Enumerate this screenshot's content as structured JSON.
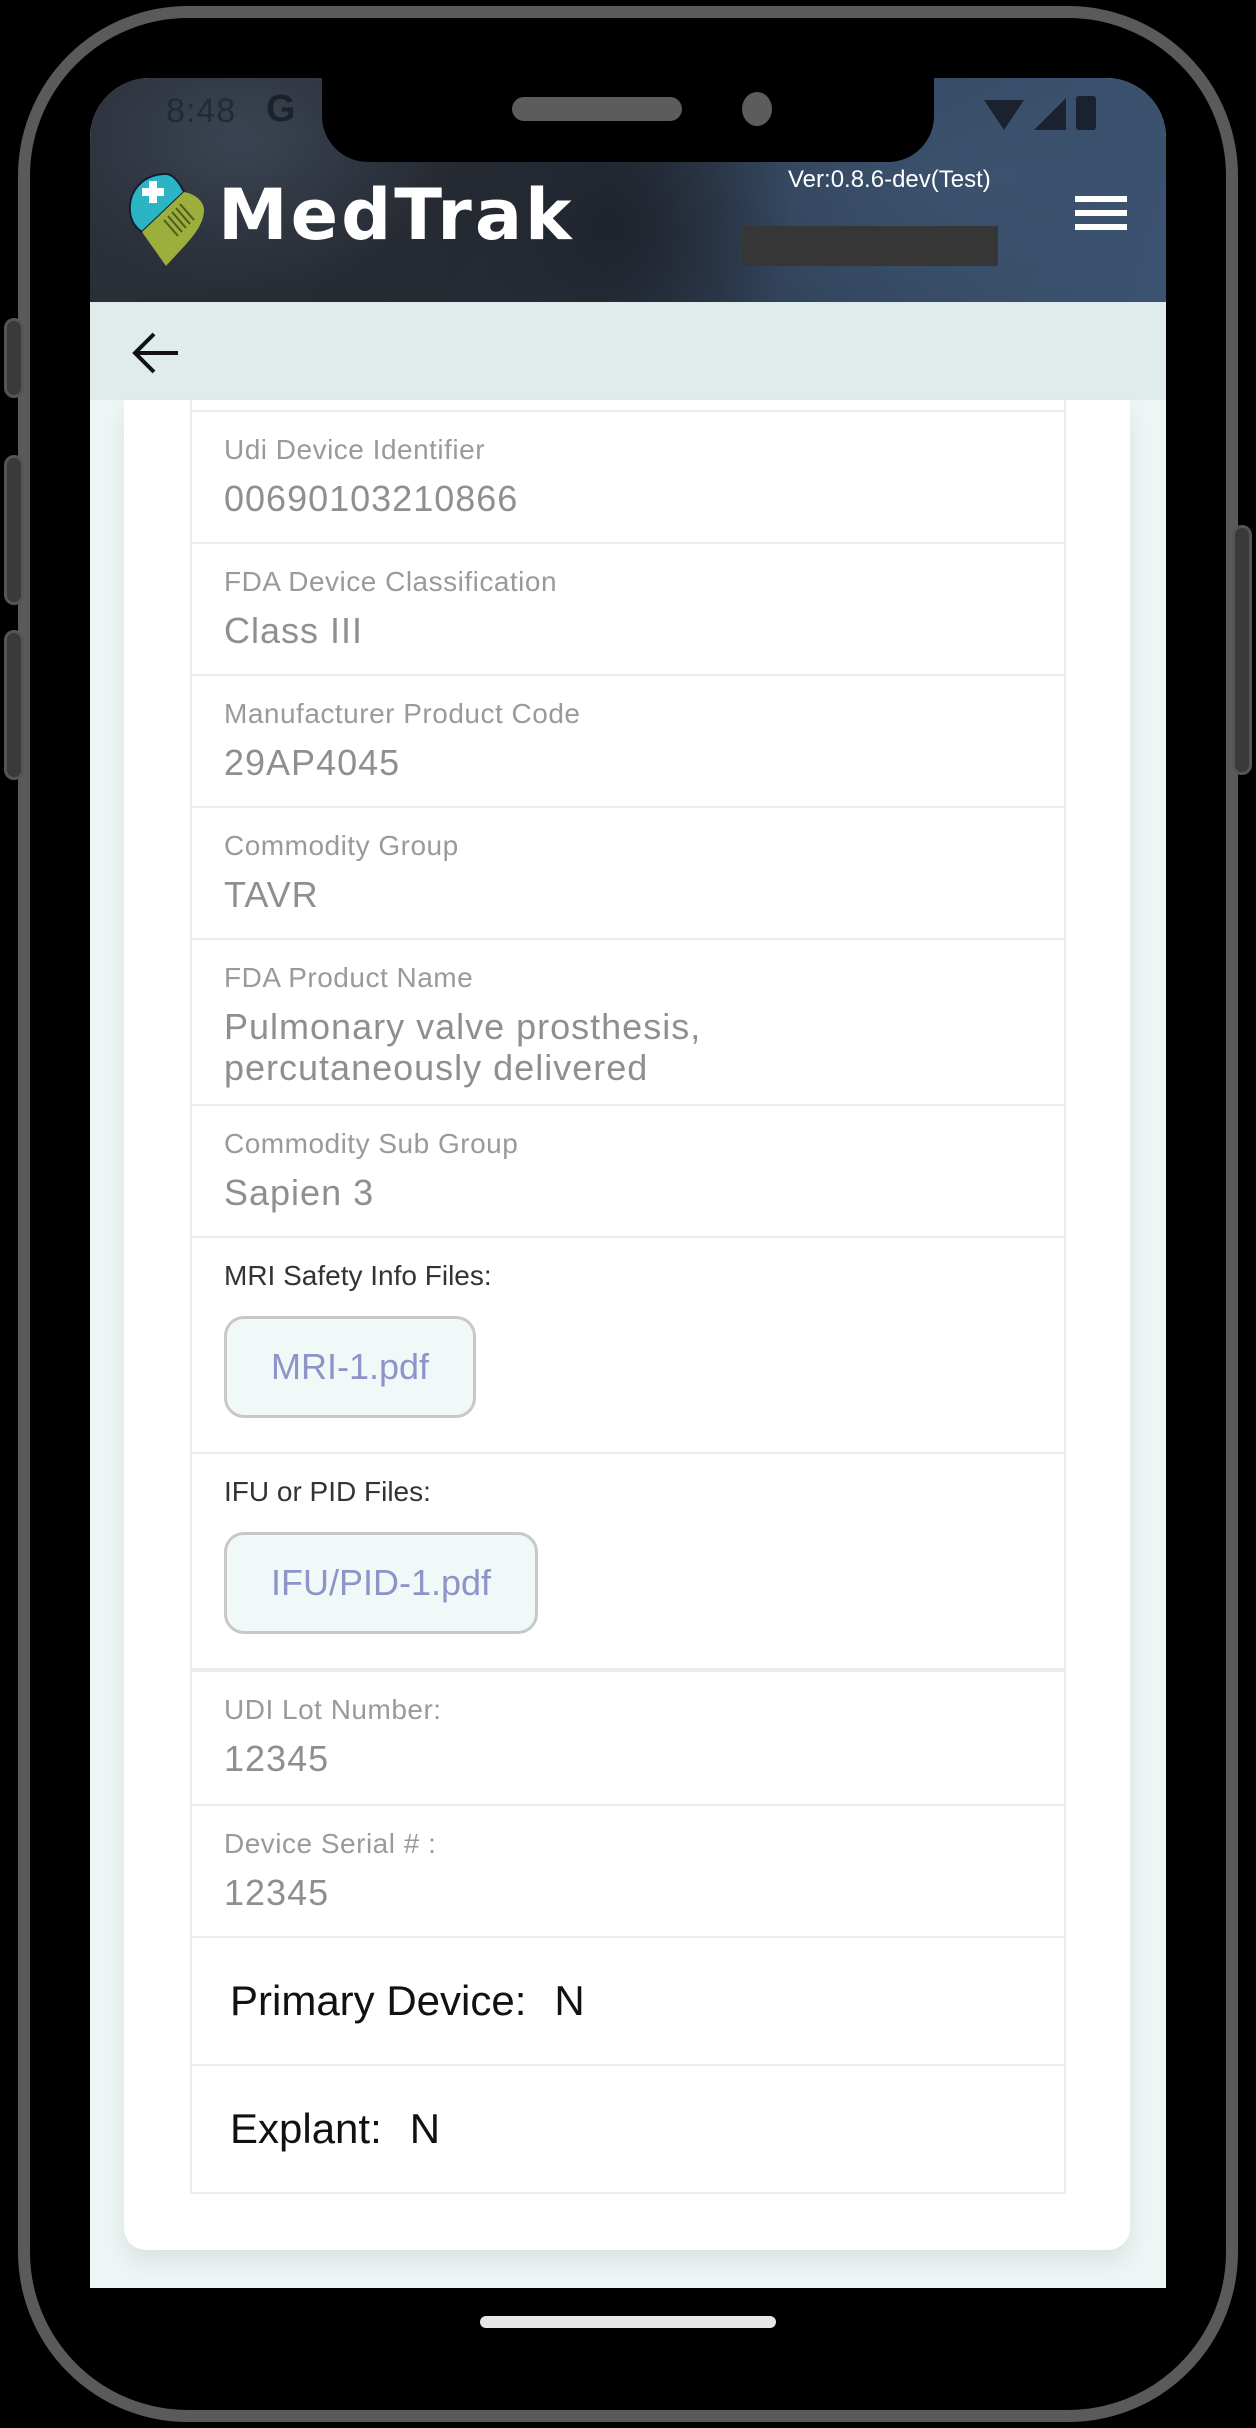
{
  "status_bar": {
    "time": "8:48",
    "carrier_glyph": "G"
  },
  "header": {
    "app_name": "MedTrak",
    "version": "Ver:0.8.6-dev(Test)",
    "logo_icon": "medtrak-pin-logo",
    "menu_icon": "hamburger-menu-icon"
  },
  "nav": {
    "back_icon": "arrow-left-icon"
  },
  "colors": {
    "header_bg": "#2f3f55",
    "back_bar_bg": "#e0ecec",
    "file_link": "#8e93c9",
    "file_chip_bg": "#f1f8f8",
    "label_gray": "#9a9a9a"
  },
  "fields": [
    {
      "label": "Udi Device Identifier",
      "value": "00690103210866"
    },
    {
      "label": "FDA Device Classification",
      "value": "Class III"
    },
    {
      "label": "Manufacturer Product Code",
      "value": "29AP4045"
    },
    {
      "label": "Commodity Group",
      "value": "TAVR"
    },
    {
      "label": "FDA Product Name",
      "value": "Pulmonary valve prosthesis, percutaneously delivered"
    },
    {
      "label": "Commodity Sub Group",
      "value": "Sapien 3"
    }
  ],
  "files": [
    {
      "label": "MRI Safety Info Files:",
      "file": "MRI-1.pdf"
    },
    {
      "label": "IFU or PID Files:",
      "file": "IFU/PID-1.pdf"
    }
  ],
  "lot_serial": [
    {
      "label": "UDI Lot Number:",
      "value": "12345"
    },
    {
      "label": "Device Serial # :",
      "value": "12345"
    }
  ],
  "flags": [
    {
      "label": "Primary Device:",
      "value": "N"
    },
    {
      "label": "Explant:",
      "value": "N"
    }
  ]
}
